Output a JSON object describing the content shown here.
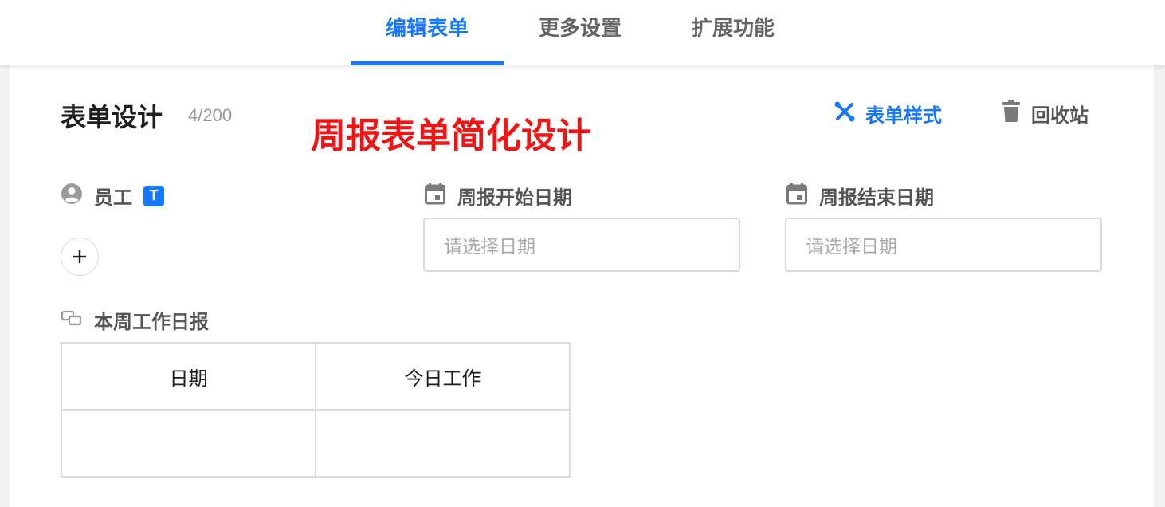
{
  "tabs": [
    {
      "label": "编辑表单",
      "active": true
    },
    {
      "label": "更多设置",
      "active": false
    },
    {
      "label": "扩展功能",
      "active": false
    }
  ],
  "design": {
    "title": "表单设计",
    "count": "4/200",
    "annotation": "周报表单简化设计",
    "style_label": "表单样式",
    "trash_label": "回收站"
  },
  "fields": {
    "employee": {
      "label": "员工",
      "badge": "T",
      "icon": "user-circle-icon",
      "add_icon": "plus-icon"
    },
    "start_date": {
      "label": "周报开始日期",
      "placeholder": "请选择日期",
      "icon": "calendar-icon"
    },
    "end_date": {
      "label": "周报结束日期",
      "placeholder": "请选择日期",
      "icon": "calendar-icon"
    },
    "daily_report": {
      "label": "本周工作日报",
      "icon": "subtable-icon",
      "columns": [
        "日期",
        "今日工作"
      ],
      "rows": [
        [
          "",
          ""
        ]
      ]
    }
  },
  "colors": {
    "accent": "#1677ff",
    "annotation": "#f21414",
    "muted_text": "#999999",
    "border": "#d9d9d9"
  }
}
